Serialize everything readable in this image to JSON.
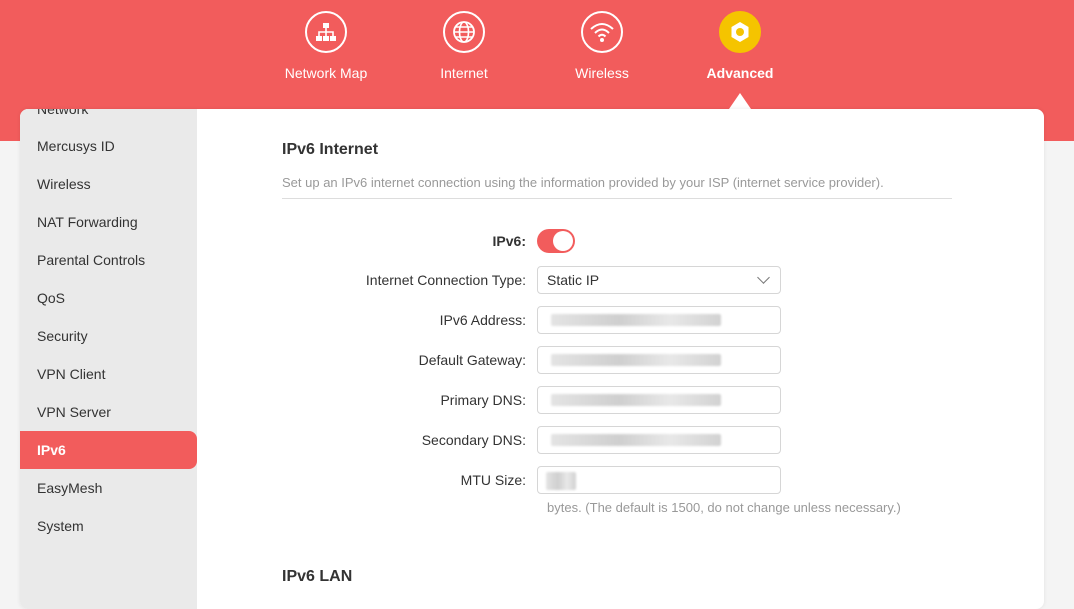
{
  "top_nav": {
    "tabs": [
      {
        "label": "Network Map",
        "icon": "network-map-icon",
        "active": false
      },
      {
        "label": "Internet",
        "icon": "globe-icon",
        "active": false
      },
      {
        "label": "Wireless",
        "icon": "wifi-icon",
        "active": false
      },
      {
        "label": "Advanced",
        "icon": "gear-icon",
        "active": true
      }
    ]
  },
  "sidebar": {
    "items": [
      {
        "label": "Network"
      },
      {
        "label": "Mercusys ID"
      },
      {
        "label": "Wireless"
      },
      {
        "label": "NAT Forwarding"
      },
      {
        "label": "Parental Controls"
      },
      {
        "label": "QoS"
      },
      {
        "label": "Security"
      },
      {
        "label": "VPN Client"
      },
      {
        "label": "VPN Server"
      },
      {
        "label": "IPv6",
        "active": true
      },
      {
        "label": "EasyMesh"
      },
      {
        "label": "System"
      }
    ]
  },
  "ipv6_internet": {
    "title": "IPv6 Internet",
    "description": "Set up an IPv6 internet connection using the information provided by your ISP (internet service provider).",
    "ipv6_label": "IPv6:",
    "ipv6_enabled": true,
    "connection_type_label": "Internet Connection Type:",
    "connection_type_value": "Static IP",
    "address_label": "IPv6 Address:",
    "gateway_label": "Default Gateway:",
    "primary_dns_label": "Primary DNS:",
    "secondary_dns_label": "Secondary DNS:",
    "mtu_label": "MTU Size:",
    "mtu_hint": "bytes. (The default is 1500, do not change unless necessary.)"
  },
  "ipv6_lan": {
    "title": "IPv6 LAN"
  },
  "colors": {
    "accent": "#f25c5c",
    "active_icon": "#f5c400",
    "sidebar_bg": "#eaeaea"
  }
}
